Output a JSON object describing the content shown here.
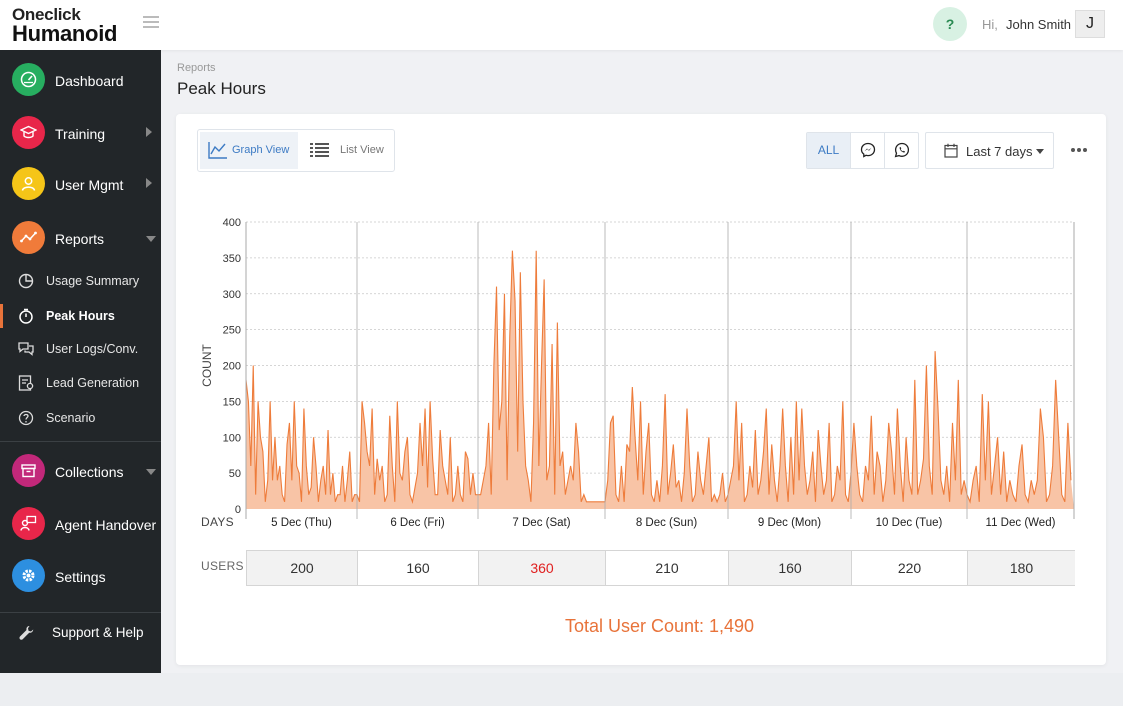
{
  "app": {
    "logo_top": "Oneclick",
    "logo_bottom": "Humanoid"
  },
  "header": {
    "help_label": "?",
    "greeting": "Hi,",
    "user_name": "John Smith",
    "avatar_initial": "J"
  },
  "sidebar": {
    "items": [
      {
        "label": "Dashboard",
        "icon": "gauge-icon",
        "color": "#27ae60",
        "has_arrow": false
      },
      {
        "label": "Training",
        "icon": "graduation-cap-icon",
        "color": "#e8264a",
        "has_arrow": "right"
      },
      {
        "label": "User Mgmt",
        "icon": "user-icon",
        "color": "#f5c518",
        "has_arrow": "right"
      },
      {
        "label": "Reports",
        "icon": "line-chart-icon",
        "color": "#f07b3a",
        "has_arrow": "down"
      },
      {
        "label": "Collections",
        "icon": "archive-icon",
        "color": "#c2287a",
        "has_arrow": "down"
      },
      {
        "label": "Agent Handover",
        "icon": "agent-icon",
        "color": "#e8264a",
        "has_arrow": false
      },
      {
        "label": "Settings",
        "icon": "gear-icon",
        "color": "#2d8fe0",
        "has_arrow": false
      }
    ],
    "reports_sub": [
      {
        "label": "Usage Summary",
        "icon": "pie-chart-icon"
      },
      {
        "label": "Peak Hours",
        "icon": "stopwatch-icon",
        "active": true
      },
      {
        "label": "User Logs/Conv.",
        "icon": "chat-bubbles-icon"
      },
      {
        "label": "Lead Generation",
        "icon": "lead-form-icon"
      },
      {
        "label": "Scenario",
        "icon": "question-bubble-icon"
      }
    ],
    "support_label": "Support & Help"
  },
  "page": {
    "breadcrumb": "Reports",
    "title": "Peak Hours"
  },
  "toolbar": {
    "graph_view": "Graph View",
    "list_view": "List View",
    "channel_all": "ALL",
    "channels": [
      "messenger-icon",
      "whatsapp-icon"
    ],
    "date_range": "Last 7 days"
  },
  "chart_data": {
    "type": "area",
    "title": "",
    "xlabel": "DAYS",
    "ylabel": "COUNT",
    "ylim": [
      0,
      400
    ],
    "yticks": [
      0,
      50,
      100,
      150,
      200,
      250,
      300,
      350,
      400
    ],
    "grid": true,
    "color": "#ee7c3b",
    "fill": "#f8c4a6",
    "days": [
      "5 Dec (Thu)",
      "6 Dec (Fri)",
      "7 Dec (Sat)",
      "8 Dec (Sun)",
      "9 Dec (Mon)",
      "10 Dec (Tue)",
      "11 Dec (Wed)"
    ],
    "series": [
      {
        "values": [
          [
            180,
            150,
            60,
            200,
            20,
            150,
            100,
            80,
            10,
            40,
            150,
            40,
            100,
            40,
            60,
            20,
            10,
            90,
            120,
            40,
            150,
            60,
            50,
            10,
            140,
            60,
            20,
            30,
            100,
            60,
            10,
            40,
            60,
            20,
            110,
            20,
            50,
            10,
            20,
            20,
            60,
            10,
            40,
            80,
            10,
            20
          ],
          [
            20,
            10,
            150,
            120,
            80,
            60,
            140,
            20,
            70,
            40,
            60,
            10,
            20,
            130,
            60,
            10,
            150,
            50,
            40,
            80,
            100,
            20,
            10,
            30,
            50,
            120,
            60,
            140,
            30,
            150,
            70,
            20,
            20,
            110,
            60,
            40,
            20,
            100,
            10,
            20,
            60,
            20,
            10,
            80,
            70,
            20,
            50,
            20
          ],
          [
            20,
            20,
            40,
            60,
            120,
            20,
            200,
            310,
            110,
            150,
            300,
            40,
            240,
            360,
            290,
            80,
            330,
            150,
            60,
            40,
            10,
            120,
            360,
            60,
            200,
            320,
            40,
            60,
            230,
            20,
            260,
            60,
            80,
            20,
            40,
            60,
            40,
            120,
            80,
            10,
            20,
            10,
            10,
            10,
            10,
            10,
            10,
            10
          ],
          [
            10,
            40,
            120,
            130,
            20,
            10,
            60,
            10,
            90,
            80,
            170,
            100,
            40,
            150,
            20,
            80,
            120,
            20,
            10,
            40,
            10,
            60,
            160,
            20,
            50,
            90,
            30,
            40,
            10,
            50,
            140,
            60,
            10,
            20,
            80,
            40,
            20,
            60,
            100,
            10,
            20,
            10,
            20,
            50,
            10
          ],
          [
            20,
            40,
            60,
            150,
            40,
            120,
            10,
            20,
            60,
            30,
            110,
            20,
            40,
            80,
            140,
            20,
            90,
            40,
            10,
            60,
            140,
            60,
            10,
            100,
            20,
            150,
            40,
            140,
            60,
            20,
            40,
            80,
            10,
            110,
            60,
            20,
            40,
            120,
            10,
            20,
            60,
            40,
            150,
            20,
            10
          ],
          [
            50,
            120,
            60,
            20,
            10,
            60,
            40,
            130,
            20,
            80,
            60,
            10,
            40,
            120,
            80,
            20,
            140,
            60,
            10,
            100,
            40,
            20,
            180,
            20,
            40,
            70,
            200,
            60,
            20,
            220,
            140,
            40,
            20,
            60,
            10,
            120,
            40,
            180,
            20,
            40
          ],
          [
            20,
            10,
            40,
            60,
            10,
            160,
            40,
            150,
            20,
            60,
            100,
            20,
            80,
            10,
            40,
            20,
            10,
            60,
            90,
            20,
            10,
            40,
            20,
            40,
            140,
            100,
            10,
            20,
            60,
            180,
            100,
            20,
            10,
            120,
            40
          ]
        ]
      }
    ]
  },
  "users_row": {
    "label": "USERS",
    "values": [
      "200",
      "160",
      "360",
      "210",
      "160",
      "220",
      "180"
    ],
    "peak_index": 2
  },
  "total": {
    "text": "Total User Count: 1,490"
  }
}
